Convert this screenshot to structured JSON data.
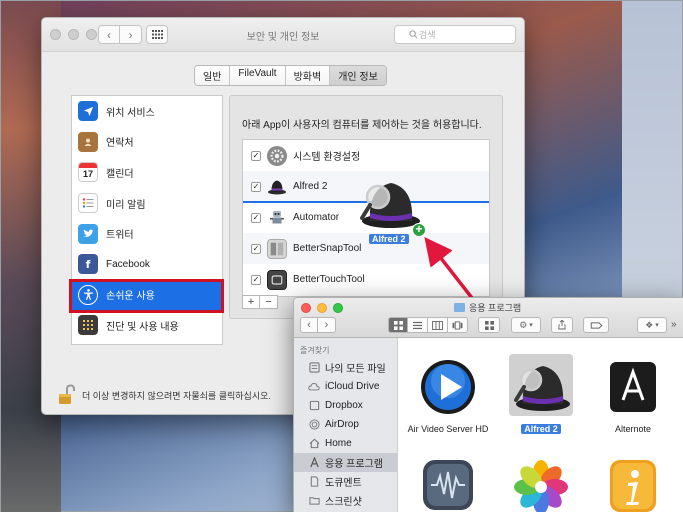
{
  "prefs": {
    "title": "보안 및 개인 정보",
    "search_placeholder": "검색",
    "tabs": [
      {
        "label": "일반",
        "active": false
      },
      {
        "label": "FileVault",
        "active": false
      },
      {
        "label": "방화벽",
        "active": false
      },
      {
        "label": "개인 정보",
        "active": true
      }
    ],
    "sidebar": [
      {
        "label": "위치 서비스",
        "icon": "location-arrow-icon",
        "color": "#1e6fd6"
      },
      {
        "label": "연락처",
        "icon": "contacts-book-icon",
        "color": "#a8743e"
      },
      {
        "label": "캘린더",
        "icon": "calendar-icon",
        "color": "#ffffff",
        "day": "17"
      },
      {
        "label": "미리 알림",
        "icon": "reminders-list-icon",
        "color": "#ffffff"
      },
      {
        "label": "트위터",
        "icon": "twitter-bird-icon",
        "color": "#3ea0e6"
      },
      {
        "label": "Facebook",
        "icon": "facebook-icon",
        "color": "#3b5998"
      },
      {
        "label": "손쉬운 사용",
        "icon": "accessibility-icon",
        "color": "#1c6fe4",
        "selected": true
      },
      {
        "label": "진단 및 사용 내용",
        "icon": "diagnostics-grid-icon",
        "color": "#3b3b3b"
      }
    ],
    "panel_heading": "아래 App이 사용자의 컴퓨터를 제어하는 것을 허용합니다.",
    "apps": [
      {
        "label": "시스템 환경설정",
        "checked": true,
        "icon": "system-preferences-icon"
      },
      {
        "label": "Alfred 2",
        "checked": true,
        "icon": "alfred-hat-icon"
      },
      {
        "label": "Automator",
        "checked": true,
        "icon": "automator-robot-icon"
      },
      {
        "label": "BetterSnapTool",
        "checked": true,
        "icon": "bettersnaptool-icon"
      },
      {
        "label": "BetterTouchTool",
        "checked": true,
        "icon": "bettertouchtool-icon"
      }
    ],
    "plus": "+",
    "minus": "−",
    "lock_text": "더 이상 변경하지 않으려면 자물쇠를 클릭하십시오."
  },
  "drag": {
    "label": "Alfred 2",
    "badge": "+"
  },
  "finder": {
    "title": "응용 프로그램",
    "sidebar_header": "즐겨찾기",
    "sidebar": [
      {
        "label": "나의 모든 파일",
        "icon": "all-files-icon"
      },
      {
        "label": "iCloud Drive",
        "icon": "cloud-icon"
      },
      {
        "label": "Dropbox",
        "icon": "dropbox-icon"
      },
      {
        "label": "AirDrop",
        "icon": "airdrop-icon"
      },
      {
        "label": "Home",
        "icon": "home-icon"
      },
      {
        "label": "응용 프로그램",
        "icon": "applications-icon",
        "selected": true
      },
      {
        "label": "도큐멘트",
        "icon": "documents-icon"
      },
      {
        "label": "스크린샷",
        "icon": "folder-icon"
      }
    ],
    "apps": [
      {
        "label": "Air Video Server HD",
        "icon": "air-video-play-icon"
      },
      {
        "label": "Alfred 2",
        "icon": "alfred-hat-icon",
        "selected": true
      },
      {
        "label": "Alternote",
        "icon": "alternote-a-icon"
      }
    ]
  }
}
